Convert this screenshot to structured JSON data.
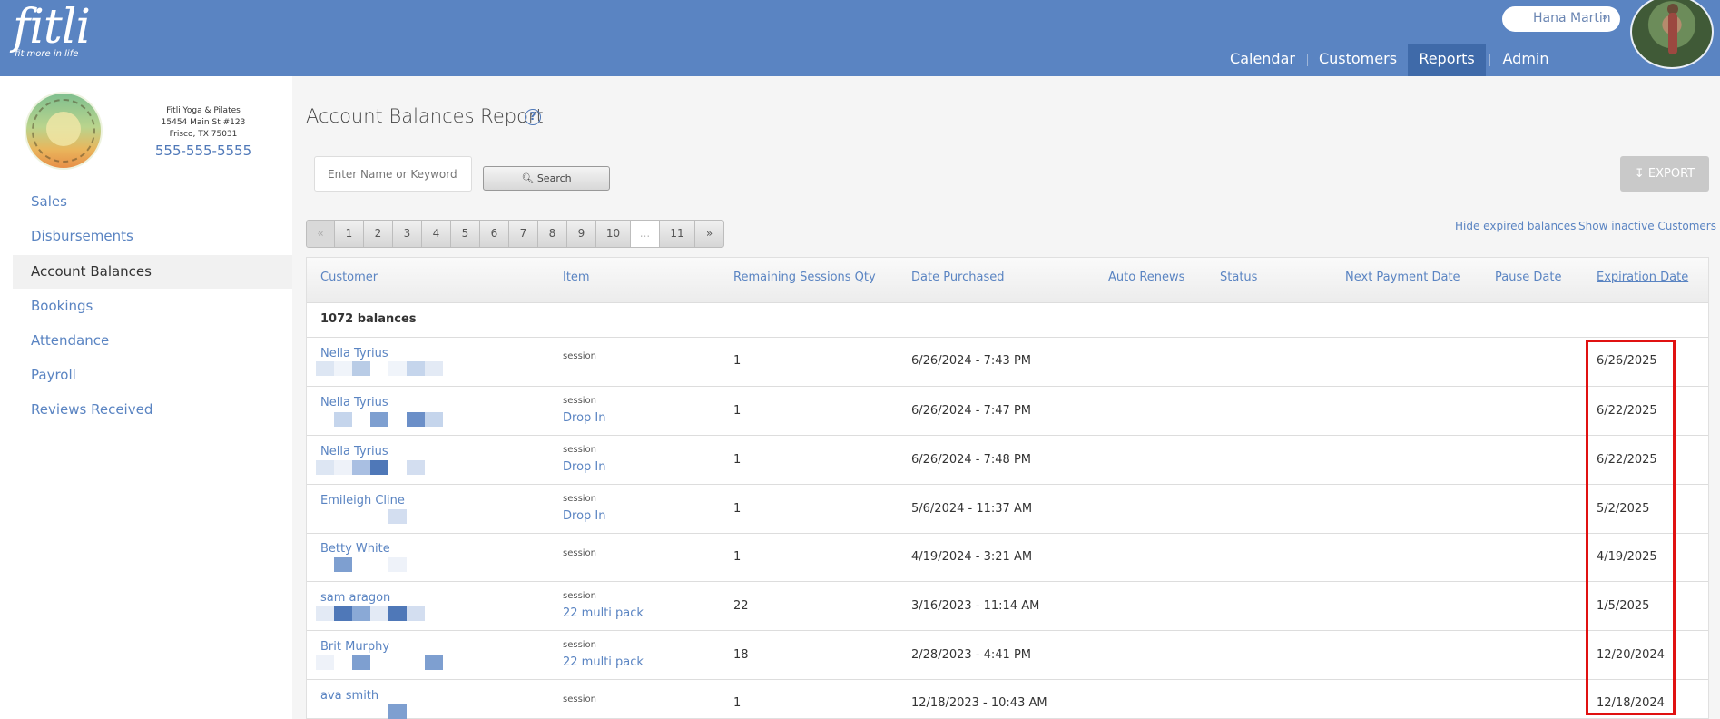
{
  "brand": {
    "logo": "fitli",
    "tagline": "fit more in life"
  },
  "user": {
    "name": "Hana Martin",
    "menu_icon": "chevron-double-down-icon"
  },
  "nav": [
    {
      "label": "Calendar",
      "active": false
    },
    {
      "label": "Customers",
      "active": false
    },
    {
      "label": "Reports",
      "active": true
    },
    {
      "label": "Admin",
      "active": false
    }
  ],
  "studio": {
    "name": "Fitli Yoga & Pilates",
    "address1": "15454 Main St #123",
    "address2": "Frisco, TX 75031",
    "phone": "555-555-5555"
  },
  "sidebar": [
    {
      "label": "Sales",
      "active": false
    },
    {
      "label": "Disbursements",
      "active": false
    },
    {
      "label": "Account Balances",
      "active": true
    },
    {
      "label": "Bookings",
      "active": false
    },
    {
      "label": "Attendance",
      "active": false
    },
    {
      "label": "Payroll",
      "active": false
    },
    {
      "label": "Reviews Received",
      "active": false
    }
  ],
  "report": {
    "title": "Account Balances Report",
    "search_placeholder": "Enter Name or Keyword",
    "search_label": "Search",
    "export_label": "EXPORT",
    "hide_expired": "Hide expired balances",
    "show_inactive": "Show inactive Customers",
    "pages": [
      "«",
      "1",
      "2",
      "3",
      "4",
      "5",
      "6",
      "7",
      "8",
      "9",
      "10",
      "...",
      "11",
      "»"
    ],
    "columns": [
      "Customer",
      "Item",
      "Remaining Sessions Qty",
      "Date Purchased",
      "Auto Renews",
      "Status",
      "Next Payment Date",
      "Pause Date",
      "Expiration Date"
    ],
    "sorted_column": "Expiration Date",
    "count_label": "1072 balances"
  },
  "rows": [
    {
      "customer": "Nella Tyrius",
      "type": "session",
      "item": "",
      "qty": "1",
      "purchased": "6/26/2024 - 7:43 PM",
      "expiration": "6/26/2025"
    },
    {
      "customer": "Nella Tyrius",
      "type": "session",
      "item": "Drop In",
      "qty": "1",
      "purchased": "6/26/2024 - 7:47 PM",
      "expiration": "6/22/2025"
    },
    {
      "customer": "Nella Tyrius",
      "type": "session",
      "item": "Drop In",
      "qty": "1",
      "purchased": "6/26/2024 - 7:48 PM",
      "expiration": "6/22/2025"
    },
    {
      "customer": "Emileigh Cline",
      "type": "session",
      "item": "Drop In",
      "qty": "1",
      "purchased": "5/6/2024 - 11:37 AM",
      "expiration": "5/2/2025"
    },
    {
      "customer": "Betty White",
      "type": "session",
      "item": "",
      "qty": "1",
      "purchased": "4/19/2024 - 3:21 AM",
      "expiration": "4/19/2025"
    },
    {
      "customer": "sam aragon",
      "type": "session",
      "item": "22 multi pack",
      "qty": "22",
      "purchased": "3/16/2023 - 11:14 AM",
      "expiration": "1/5/2025"
    },
    {
      "customer": "Brit Murphy",
      "type": "session",
      "item": "22 multi pack",
      "qty": "18",
      "purchased": "2/28/2023 - 4:41 PM",
      "expiration": "12/20/2024"
    },
    {
      "customer": "ava smith",
      "type": "session",
      "item": "",
      "qty": "1",
      "purchased": "12/18/2023 - 10:43 AM",
      "expiration": "12/18/2024"
    }
  ],
  "colors": {
    "header": "#5a84c2",
    "nav_active": "#3f6aa9",
    "link": "#5a84c2",
    "highlight": "#e01111"
  }
}
